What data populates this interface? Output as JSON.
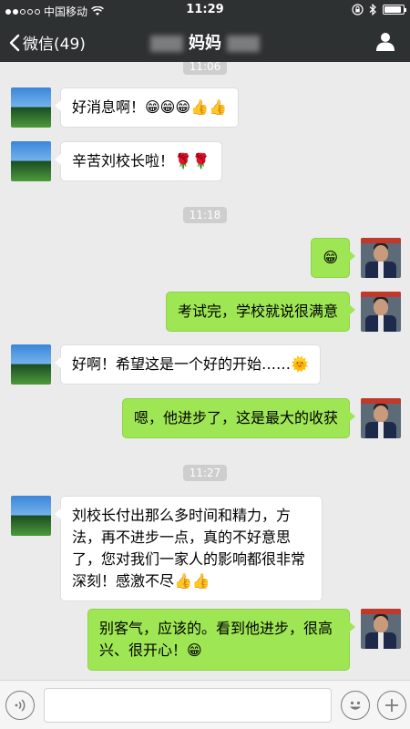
{
  "status_bar": {
    "carrier": "中国移动",
    "time": "11:29",
    "battery_level": 0.9
  },
  "nav": {
    "back_label": "微信(49)",
    "title": "妈妈"
  },
  "timestamps": [
    "11:06",
    "11:18",
    "11:27"
  ],
  "messages": [
    {
      "side": "in",
      "text": "好消息啊！😁😁😁👍👍"
    },
    {
      "side": "in",
      "text": "辛苦刘校长啦！🌹🌹"
    },
    {
      "side": "out",
      "text": "😁"
    },
    {
      "side": "out",
      "text": "考试完，学校就说很满意"
    },
    {
      "side": "in",
      "text": "好啊！希望这是一个好的开始……🌞"
    },
    {
      "side": "out",
      "text": "嗯，他进步了，这是最大的收获"
    },
    {
      "side": "in",
      "text": "刘校长付出那么多时间和精力，方法，再不进步一点，真的不好意思了，您对我们一家人的影响都很非常深刻！感激不尽👍👍"
    },
    {
      "side": "out",
      "text": "别客气，应该的。看到他进步，很高兴、很开心！😁"
    }
  ],
  "icons": {
    "signal": "signal-dots-icon",
    "wifi": "wifi-icon",
    "lock": "rotation-lock-icon",
    "bluetooth": "bluetooth-icon",
    "battery": "battery-icon",
    "back": "chevron-left-icon",
    "profile": "person-icon",
    "voice": "voice-icon",
    "emoji": "emoji-icon",
    "add": "plus-icon"
  },
  "colors": {
    "nav_bg": "#2e3132",
    "chat_bg": "#ebebeb",
    "outgoing_bubble": "#9ee653",
    "incoming_bubble": "#ffffff"
  }
}
